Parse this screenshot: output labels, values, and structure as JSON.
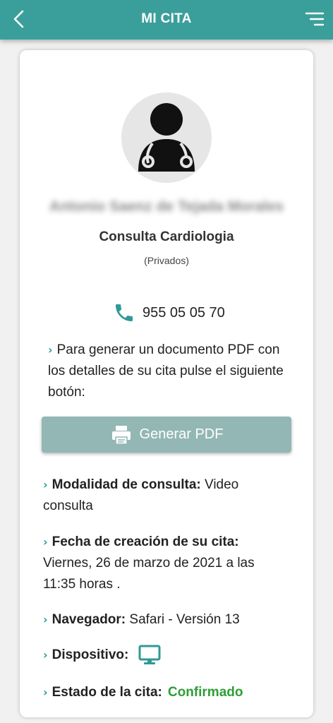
{
  "header": {
    "title": "MI CITA",
    "back_icon": "chevron-left-icon",
    "menu_icon": "menu-icon"
  },
  "doctor": {
    "name": "Antonio Saenz de Tejada Morales",
    "specialty": "Consulta Cardiologia",
    "category": "(Privados)",
    "avatar_icon": "doctor-avatar-icon"
  },
  "phone": {
    "icon": "phone-icon",
    "number": "955 05 05 70"
  },
  "pdf": {
    "info": "Para generar un documento PDF con los detalles de su cita pulse el siguiente botón:",
    "button_label": "Generar PDF",
    "button_icon": "printer-icon"
  },
  "details": {
    "modality_label": "Modalidad de consulta:",
    "modality_value": "Video consulta",
    "created_label": "Fecha de creación de su cita:",
    "created_value": "Viernes, 26 de marzo de 2021 a las 11:35 horas .",
    "browser_label": "Navegador:",
    "browser_value": "Safari - Versión 13",
    "device_label": "Dispositivo:",
    "device_icon": "monitor-icon",
    "status_label": "Estado de la cita:",
    "status_value": "Confirmado"
  },
  "colors": {
    "primary": "#3a9f9b",
    "button": "#93b7b5",
    "success": "#2e9e35"
  }
}
